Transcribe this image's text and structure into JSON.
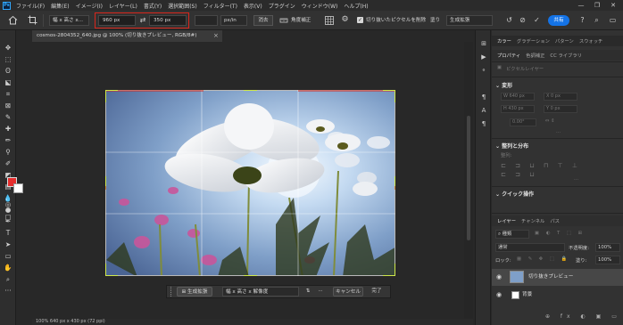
{
  "app": {
    "logo": "Ps"
  },
  "menubar": {
    "items": [
      "ファイル(F)",
      "編集(E)",
      "イメージ(I)",
      "レイヤー(L)",
      "書式(Y)",
      "選択範囲(S)",
      "フィルター(T)",
      "表示(V)",
      "プラグイン",
      "ウィンドウ(W)",
      "ヘルプ(H)"
    ]
  },
  "window_controls": [
    "—",
    "❐",
    "✕"
  ],
  "options_bar": {
    "ratio_select": "幅 x 高さ x...",
    "width_value": "960 px",
    "height_value": "350 px",
    "unit_select": "px/in",
    "clear_label": "消去",
    "straighten_label": "角度補正",
    "delete_cropped_label": "切り抜いたピクセルを削除",
    "fill_label": "塗り",
    "fill_select": "生成拡張",
    "share_label": "共有"
  },
  "document": {
    "tab_title": "cosmos-2804352_640.jpg @ 100% (切り抜きプレビュー, RGB/8#)",
    "status_text": "100%      640 px x 430 px (72 ppi)"
  },
  "crop_context_bar": {
    "generative_expand": "生成拡張",
    "ratio_res": "幅 x 高さ x 解像度",
    "more": "···",
    "cancel": "キャンセル",
    "done": "完了"
  },
  "right_panel": {
    "top_tabs": [
      "カラー",
      "グラデーション",
      "パターン",
      "スウォッチ"
    ],
    "prop_tabs": [
      "プロパティ",
      "色調補正",
      "CC ライブラリ"
    ],
    "pixel_layer_label": "ピクセルレイヤー",
    "transform_title": "変形",
    "transform_fields": [
      "W 640 px",
      "H 430 px",
      "X 0 px",
      "Y 0 px",
      "0.00°"
    ],
    "align_title": "整列と分布",
    "align_sub": "整列:",
    "quick_actions_title": "クイック操作",
    "layer_tabs": [
      "レイヤー",
      "チャンネル",
      "パス"
    ],
    "layer_search": "種類",
    "blend_mode": "通常",
    "opacity_label": "不透明度:",
    "opacity_value": "100%",
    "lock_label": "ロック:",
    "fill_label": "塗り:",
    "fill_value": "100%",
    "layers": [
      {
        "name": "切り抜きプレビュー"
      },
      {
        "name": "背景"
      }
    ]
  }
}
